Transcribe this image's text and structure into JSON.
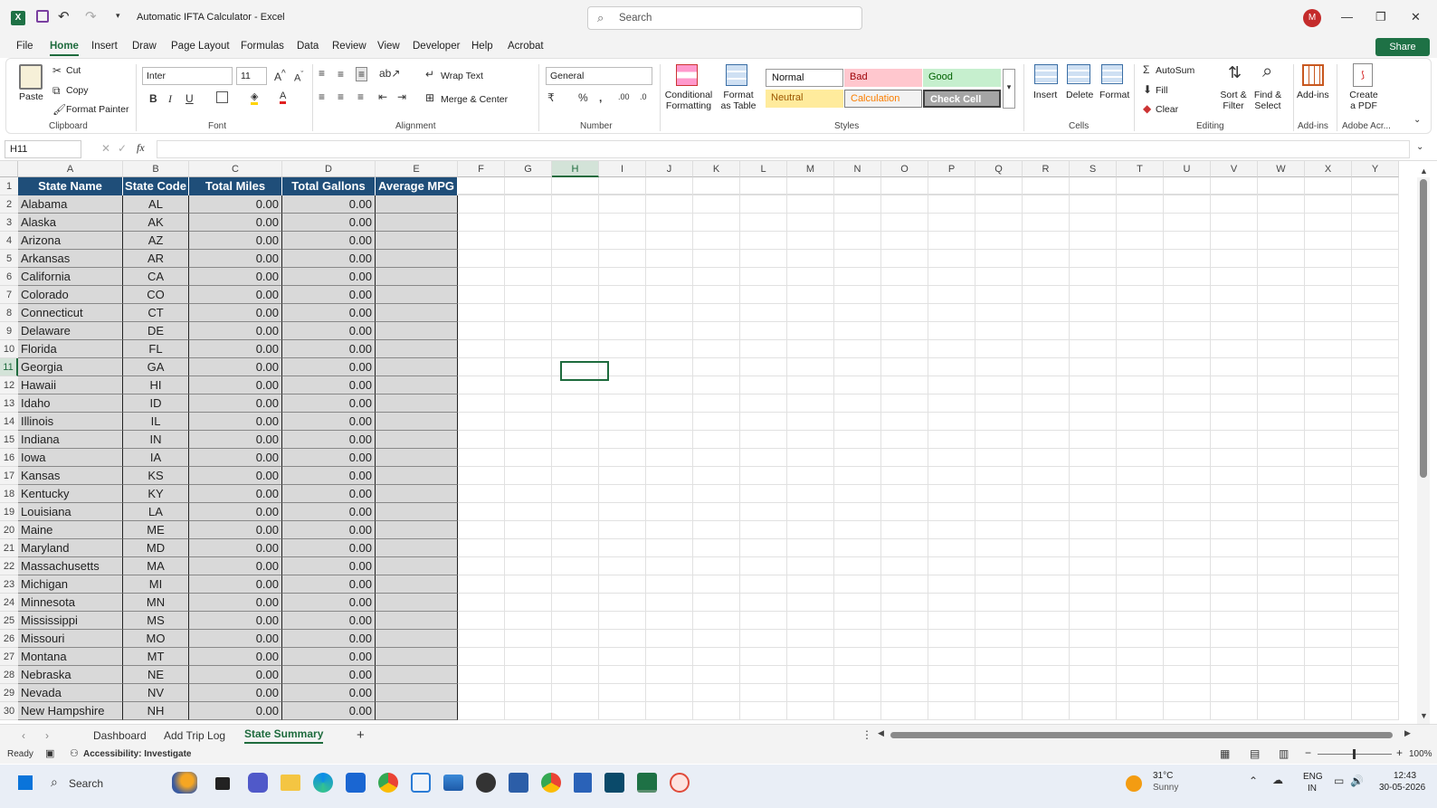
{
  "window": {
    "title": "Automatic IFTA Calculator  -  Excel",
    "search_placeholder": "Search",
    "avatar_initial": "M"
  },
  "menu_tabs": [
    "File",
    "Home",
    "Insert",
    "Draw",
    "Page Layout",
    "Formulas",
    "Data",
    "Review",
    "View",
    "Developer",
    "Help",
    "Acrobat"
  ],
  "active_tab": "Home",
  "share_label": "Share",
  "ribbon": {
    "clipboard": {
      "group": "Clipboard",
      "paste": "Paste",
      "cut": "Cut",
      "copy": "Copy",
      "format_painter": "Format Painter"
    },
    "font": {
      "group": "Font",
      "font_name": "Inter",
      "font_size": "11"
    },
    "alignment": {
      "group": "Alignment",
      "wrap_text": "Wrap Text",
      "merge_center": "Merge & Center"
    },
    "number": {
      "group": "Number",
      "format": "General"
    },
    "styles": {
      "group": "Styles",
      "conditional": "Conditional Formatting",
      "format_table": "Format as Table",
      "normal": "Normal",
      "bad": "Bad",
      "good": "Good",
      "neutral": "Neutral",
      "calculation": "Calculation",
      "check_cell": "Check Cell"
    },
    "cells": {
      "group": "Cells",
      "insert": "Insert",
      "delete": "Delete",
      "format": "Format"
    },
    "editing": {
      "group": "Editing",
      "autosum": "AutoSum",
      "fill": "Fill",
      "clear": "Clear",
      "sort_filter": "Sort & Filter",
      "find_select": "Find & Select"
    },
    "addins": {
      "group": "Add-ins",
      "addins": "Add-ins"
    },
    "adobe": {
      "group": "Adobe Acr...",
      "create_pdf": "Create a PDF"
    }
  },
  "formula_bar": {
    "name_box": "H11",
    "formula": ""
  },
  "columns": [
    "A",
    "B",
    "C",
    "D",
    "E",
    "F",
    "G",
    "H",
    "I",
    "J",
    "K",
    "L",
    "M",
    "N",
    "O",
    "P",
    "Q",
    "R",
    "S",
    "T",
    "U",
    "V",
    "W",
    "X",
    "Y"
  ],
  "headers": [
    "State Name",
    "State Code",
    "Total Miles",
    "Total Gallons",
    "Average MPG"
  ],
  "rows": [
    [
      "Alabama",
      "AL",
      "0.00",
      "0.00",
      ""
    ],
    [
      "Alaska",
      "AK",
      "0.00",
      "0.00",
      ""
    ],
    [
      "Arizona",
      "AZ",
      "0.00",
      "0.00",
      ""
    ],
    [
      "Arkansas",
      "AR",
      "0.00",
      "0.00",
      ""
    ],
    [
      "California",
      "CA",
      "0.00",
      "0.00",
      ""
    ],
    [
      "Colorado",
      "CO",
      "0.00",
      "0.00",
      ""
    ],
    [
      "Connecticut",
      "CT",
      "0.00",
      "0.00",
      ""
    ],
    [
      "Delaware",
      "DE",
      "0.00",
      "0.00",
      ""
    ],
    [
      "Florida",
      "FL",
      "0.00",
      "0.00",
      ""
    ],
    [
      "Georgia",
      "GA",
      "0.00",
      "0.00",
      ""
    ],
    [
      "Hawaii",
      "HI",
      "0.00",
      "0.00",
      ""
    ],
    [
      "Idaho",
      "ID",
      "0.00",
      "0.00",
      ""
    ],
    [
      "Illinois",
      "IL",
      "0.00",
      "0.00",
      ""
    ],
    [
      "Indiana",
      "IN",
      "0.00",
      "0.00",
      ""
    ],
    [
      "Iowa",
      "IA",
      "0.00",
      "0.00",
      ""
    ],
    [
      "Kansas",
      "KS",
      "0.00",
      "0.00",
      ""
    ],
    [
      "Kentucky",
      "KY",
      "0.00",
      "0.00",
      ""
    ],
    [
      "Louisiana",
      "LA",
      "0.00",
      "0.00",
      ""
    ],
    [
      "Maine",
      "ME",
      "0.00",
      "0.00",
      ""
    ],
    [
      "Maryland",
      "MD",
      "0.00",
      "0.00",
      ""
    ],
    [
      "Massachusetts",
      "MA",
      "0.00",
      "0.00",
      ""
    ],
    [
      "Michigan",
      "MI",
      "0.00",
      "0.00",
      ""
    ],
    [
      "Minnesota",
      "MN",
      "0.00",
      "0.00",
      ""
    ],
    [
      "Mississippi",
      "MS",
      "0.00",
      "0.00",
      ""
    ],
    [
      "Missouri",
      "MO",
      "0.00",
      "0.00",
      ""
    ],
    [
      "Montana",
      "MT",
      "0.00",
      "0.00",
      ""
    ],
    [
      "Nebraska",
      "NE",
      "0.00",
      "0.00",
      ""
    ],
    [
      "Nevada",
      "NV",
      "0.00",
      "0.00",
      ""
    ],
    [
      "New Hampshire",
      "NH",
      "0.00",
      "0.00",
      ""
    ]
  ],
  "sheet_tabs": [
    "Dashboard",
    "Add Trip Log",
    "State Summary"
  ],
  "active_sheet": "State Summary",
  "status": {
    "ready": "Ready",
    "accessibility": "Accessibility: Investigate",
    "zoom": "100%"
  },
  "taskbar": {
    "search": "Search",
    "weather_temp": "31°C",
    "weather_desc": "Sunny",
    "lang1": "ENG",
    "lang2": "IN",
    "time": "12:43",
    "date": "30-05-2026"
  },
  "colors": {
    "header_fill": "#1f4e79",
    "data_fill": "#d9d9d9",
    "excel_green": "#1e6b3d"
  }
}
